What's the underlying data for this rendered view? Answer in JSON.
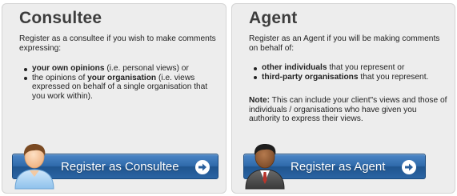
{
  "consultee": {
    "title": "Consultee",
    "intro": "Register as a consultee if you wish to make comments expressing:",
    "items": [
      {
        "bold": "your own opinions",
        "rest_before": "",
        "rest_after": " (i.e. personal views) or"
      },
      {
        "rest_before": "the opinions of ",
        "bold": "your organisation",
        "rest_after": " (i.e. views expressed on behalf of a single organisation that you work within)."
      }
    ],
    "button_label": "Register as Consultee",
    "avatar_icon": "person-icon",
    "button_icon": "arrow-right-circle-icon"
  },
  "agent": {
    "title": "Agent",
    "intro": "Register as an Agent if you will be making comments on behalf of:",
    "items": [
      {
        "bold": "other individuals",
        "rest_after": " that you represent or"
      },
      {
        "bold": "third-party organisations",
        "rest_after": " that you represent."
      }
    ],
    "note_label": "Note:",
    "note_text": " This can include your client\"s views and those of individuals / organisations who have given you authority to express their views.",
    "button_label": "Register as Agent",
    "avatar_icon": "businessman-icon",
    "button_icon": "arrow-right-circle-icon"
  },
  "colors": {
    "card_bg": "#ededed",
    "button_blue": "#2f6aab",
    "heading": "#3d3d3d"
  }
}
